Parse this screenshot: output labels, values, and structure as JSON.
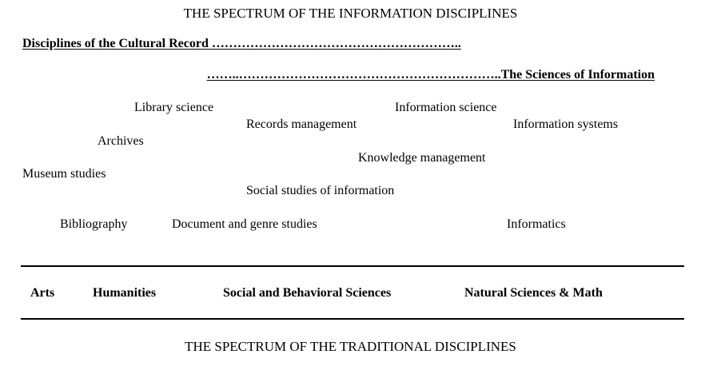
{
  "diagram": {
    "top_title": "THE SPECTRUM OF THE INFORMATION DISCIPLINES",
    "bottom_title": "THE SPECTRUM OF THE TRADITIONAL DISCIPLINES",
    "headings": {
      "cultural_record": "Disciplines of the Cultural Record …………………………………………………..",
      "sciences_of_information": "……..……………………………………………………..The Sciences of Information"
    },
    "information_disciplines": {
      "library_science": "Library science",
      "information_science": "Information science",
      "records_management": "Records management",
      "information_systems": "Information systems",
      "archives": "Archives",
      "knowledge_management": "Knowledge management",
      "museum_studies": "Museum studies",
      "social_studies_of_information": "Social studies of information",
      "bibliography": "Bibliography",
      "document_and_genre_studies": "Document and genre studies",
      "informatics": "Informatics"
    },
    "traditional_disciplines": {
      "arts": "Arts",
      "humanities": "Humanities",
      "social_behavioral_sciences": "Social and Behavioral Sciences",
      "natural_sciences_math": "Natural Sciences & Math"
    }
  }
}
